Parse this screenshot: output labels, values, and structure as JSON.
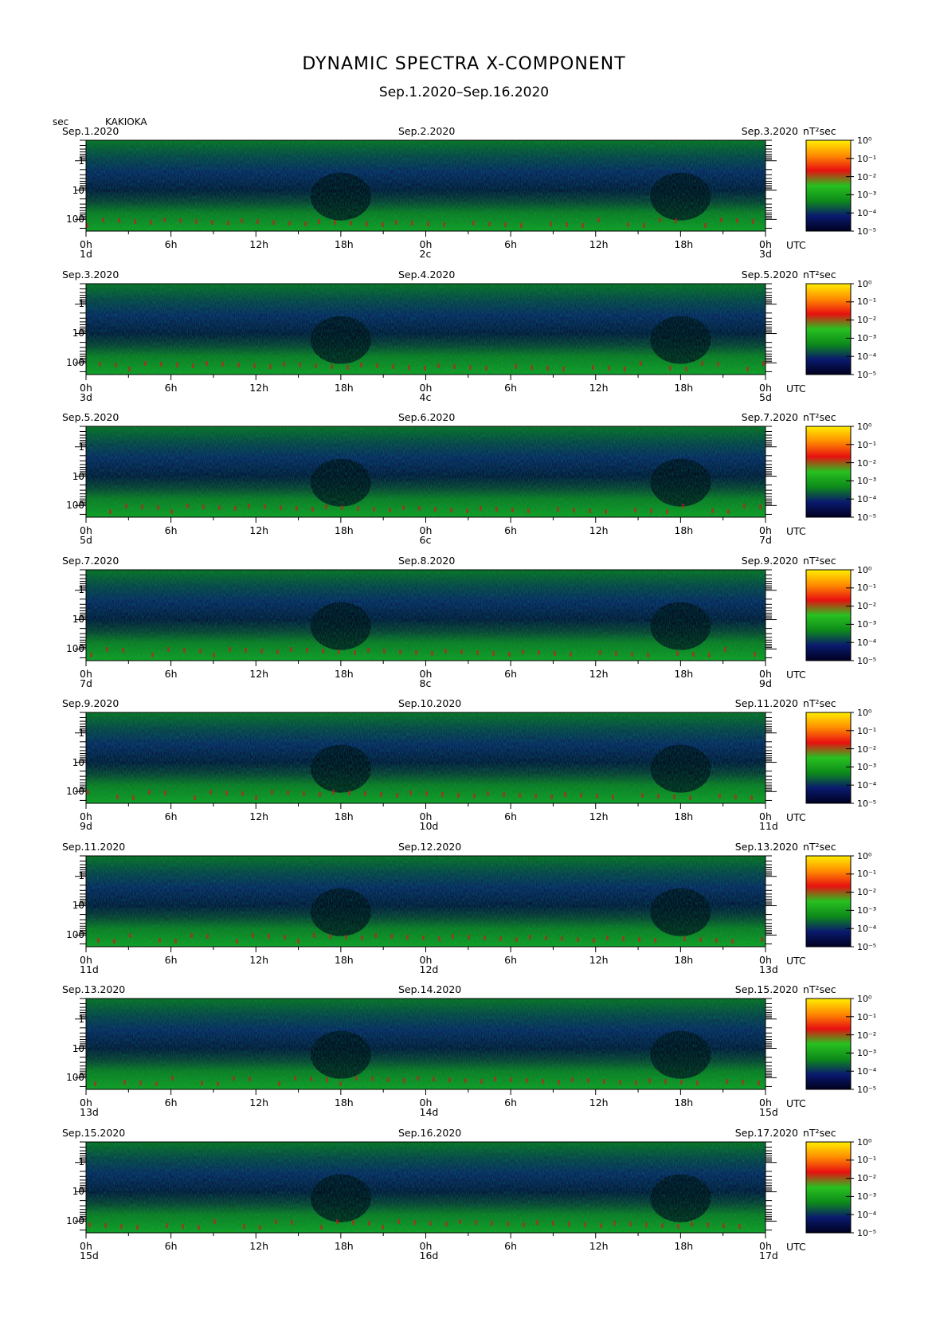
{
  "title": "DYNAMIC SPECTRA X-COMPONENT",
  "subtitle": "Sep.1.2020–Sep.16.2020",
  "station": "KAKIOKA",
  "y_unit": "sec",
  "colorbar_unit": "nT²sec",
  "colors": {
    "scale": [
      "#000020",
      "#0a1a6e",
      "#0d8a1a",
      "#28c020",
      "#e81010",
      "#ff8c00",
      "#ffee00"
    ]
  },
  "chart_data": {
    "type": "heatmap",
    "title": "DYNAMIC SPECTRA X-COMPONENT",
    "subtitle": "Sep.1.2020–Sep.16.2020",
    "ylabel": "sec",
    "y_scale": "log",
    "y_ticks": [
      "1",
      "10",
      "100"
    ],
    "x_ticks": [
      "0h",
      "6h",
      "12h",
      "18h",
      "0h",
      "6h",
      "12h",
      "18h",
      "0h"
    ],
    "x_unit": "UTC",
    "colorbar": {
      "unit": "nT²sec",
      "ticks": [
        "10⁰",
        "10⁻¹",
        "10⁻²",
        "10⁻³",
        "10⁻⁴",
        "10⁻⁵"
      ]
    },
    "panels": [
      {
        "dates": [
          "Sep.1.2020",
          "Sep.2.2020",
          "Sep.3.2020"
        ],
        "days": [
          "1d",
          "2c",
          "3d"
        ]
      },
      {
        "dates": [
          "Sep.3.2020",
          "Sep.4.2020",
          "Sep.5.2020"
        ],
        "days": [
          "3d",
          "4c",
          "5d"
        ]
      },
      {
        "dates": [
          "Sep.5.2020",
          "Sep.6.2020",
          "Sep.7.2020"
        ],
        "days": [
          "5d",
          "6c",
          "7d"
        ]
      },
      {
        "dates": [
          "Sep.7.2020",
          "Sep.8.2020",
          "Sep.9.2020"
        ],
        "days": [
          "7d",
          "8c",
          "9d"
        ]
      },
      {
        "dates": [
          "Sep.9.2020",
          "Sep.10.2020",
          "Sep.11.2020"
        ],
        "days": [
          "9d",
          "10d",
          "11d"
        ]
      },
      {
        "dates": [
          "Sep.11.2020",
          "Sep.12.2020",
          "Sep.13.2020"
        ],
        "days": [
          "11d",
          "12d",
          "13d"
        ]
      },
      {
        "dates": [
          "Sep.13.2020",
          "Sep.14.2020",
          "Sep.15.2020"
        ],
        "days": [
          "13d",
          "14d",
          "15d"
        ]
      },
      {
        "dates": [
          "Sep.15.2020",
          "Sep.16.2020",
          "Sep.17.2020"
        ],
        "days": [
          "15d",
          "16d",
          "17d"
        ]
      }
    ]
  }
}
